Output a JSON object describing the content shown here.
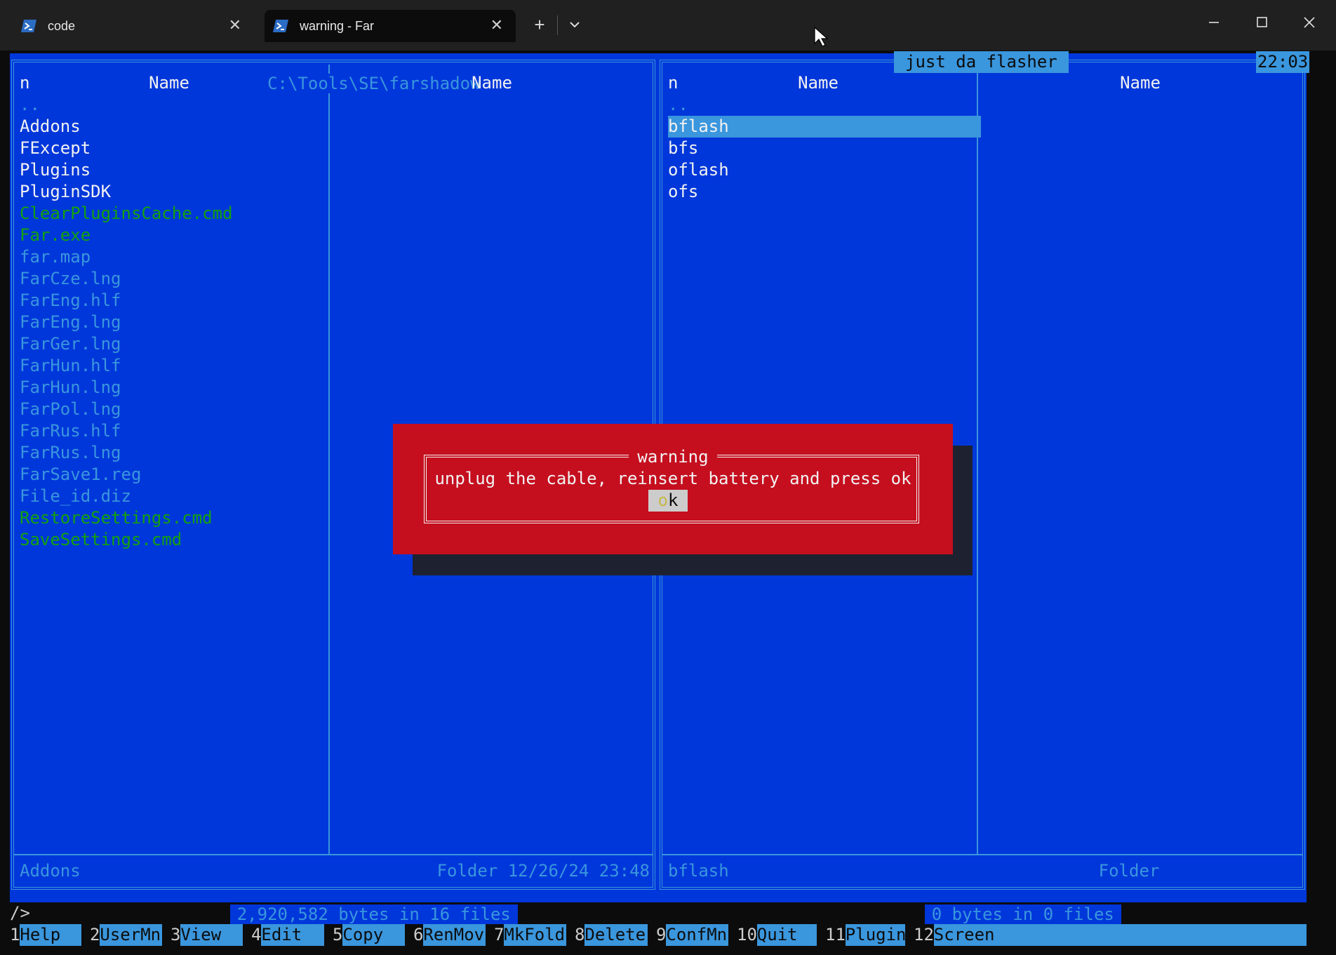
{
  "tabs": [
    {
      "label": "code",
      "active": false
    },
    {
      "label": "warning - Far",
      "active": true
    }
  ],
  "left_panel": {
    "path": "C:\\Tools\\SE\\farshadow",
    "col_n": "n",
    "col_name_1": "Name",
    "col_name_2": "Name",
    "files": [
      {
        "name": "..",
        "color": "cyan"
      },
      {
        "name": "Addons",
        "color": "white"
      },
      {
        "name": "FExcept",
        "color": "white"
      },
      {
        "name": "Plugins",
        "color": "white"
      },
      {
        "name": "PluginSDK",
        "color": "white"
      },
      {
        "name": "ClearPluginsCache.cmd",
        "color": "green"
      },
      {
        "name": "Far.exe",
        "color": "green"
      },
      {
        "name": "far.map",
        "color": "cyan"
      },
      {
        "name": "FarCze.lng",
        "color": "cyan"
      },
      {
        "name": "FarEng.hlf",
        "color": "cyan"
      },
      {
        "name": "FarEng.lng",
        "color": "cyan"
      },
      {
        "name": "FarGer.lng",
        "color": "cyan"
      },
      {
        "name": "FarHun.hlf",
        "color": "cyan"
      },
      {
        "name": "FarHun.lng",
        "color": "cyan"
      },
      {
        "name": "FarPol.lng",
        "color": "cyan"
      },
      {
        "name": "FarRus.hlf",
        "color": "cyan"
      },
      {
        "name": "FarRus.lng",
        "color": "cyan"
      },
      {
        "name": "FarSave1.reg",
        "color": "cyan"
      },
      {
        "name": "File_id.diz",
        "color": "cyan"
      },
      {
        "name": "RestoreSettings.cmd",
        "color": "green"
      },
      {
        "name": "SaveSettings.cmd",
        "color": "green"
      }
    ],
    "status_name": "Addons",
    "status_info": "Folder 12/26/24 23:48",
    "summary": "2,920,582 bytes in 16 files"
  },
  "right_panel": {
    "title": "just da flasher",
    "clock": "22:03",
    "col_n": "n",
    "col_name_1": "Name",
    "col_name_2": "Name",
    "files": [
      {
        "name": "..",
        "color": "cyan",
        "selected": false
      },
      {
        "name": "bflash",
        "color": "white",
        "selected": true
      },
      {
        "name": "bfs",
        "color": "white",
        "selected": false
      },
      {
        "name": "oflash",
        "color": "white",
        "selected": false
      },
      {
        "name": "ofs",
        "color": "white",
        "selected": false
      }
    ],
    "status_name": "bflash",
    "status_info": "Folder",
    "summary": "0 bytes in 0 files"
  },
  "dialog": {
    "title": "warning",
    "message": "unplug the cable, reinsert battery and press ok",
    "button_hotkey": "o",
    "button_rest": "k"
  },
  "command_prompt": "/>",
  "keybar": [
    {
      "num": "1",
      "label": "Help"
    },
    {
      "num": "2",
      "label": "UserMn"
    },
    {
      "num": "3",
      "label": "View"
    },
    {
      "num": "4",
      "label": "Edit"
    },
    {
      "num": "5",
      "label": "Copy"
    },
    {
      "num": "6",
      "label": "RenMov"
    },
    {
      "num": "7",
      "label": "MkFold"
    },
    {
      "num": "8",
      "label": "Delete"
    },
    {
      "num": "9",
      "label": "ConfMn"
    },
    {
      "num": "10",
      "label": "Quit"
    },
    {
      "num": "11",
      "label": "Plugin"
    },
    {
      "num": "12",
      "label": "Screen"
    }
  ],
  "colors": {
    "panel_bg": "#0037da",
    "frame": "#3a96dd",
    "dir_white": "#f2f2f2",
    "exec_green": "#13a10e",
    "dialog_red": "#c50f1f"
  },
  "icons": {
    "tab_icon": "powershell-icon",
    "new_tab": "plus-icon",
    "tab_dropdown": "chevron-down-icon",
    "minimize": "minimize-icon",
    "maximize": "maximize-icon",
    "close": "close-icon"
  }
}
